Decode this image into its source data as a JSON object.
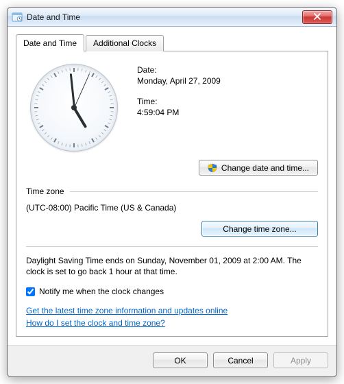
{
  "window": {
    "title": "Date and Time"
  },
  "tabs": [
    {
      "label": "Date and Time"
    },
    {
      "label": "Additional Clocks"
    }
  ],
  "datetime": {
    "date_label": "Date:",
    "date_value": "Monday, April 27, 2009",
    "time_label": "Time:",
    "time_value": "4:59:04 PM",
    "change_button": "Change date and time..."
  },
  "timezone": {
    "header": "Time zone",
    "value": "(UTC-08:00) Pacific Time (US & Canada)",
    "change_button": "Change time zone..."
  },
  "dst": {
    "text": "Daylight Saving Time ends on Sunday, November 01, 2009 at 2:00 AM. The clock is set to go back 1 hour at that time.",
    "notify_label": "Notify me when the clock changes",
    "notify_checked": true
  },
  "links": {
    "updates": "Get the latest time zone information and updates online",
    "help": "How do I set the clock and time zone?"
  },
  "buttons": {
    "ok": "OK",
    "cancel": "Cancel",
    "apply": "Apply"
  },
  "clock": {
    "hour_angle": 149,
    "minute_angle": 354,
    "second_angle": 24
  }
}
